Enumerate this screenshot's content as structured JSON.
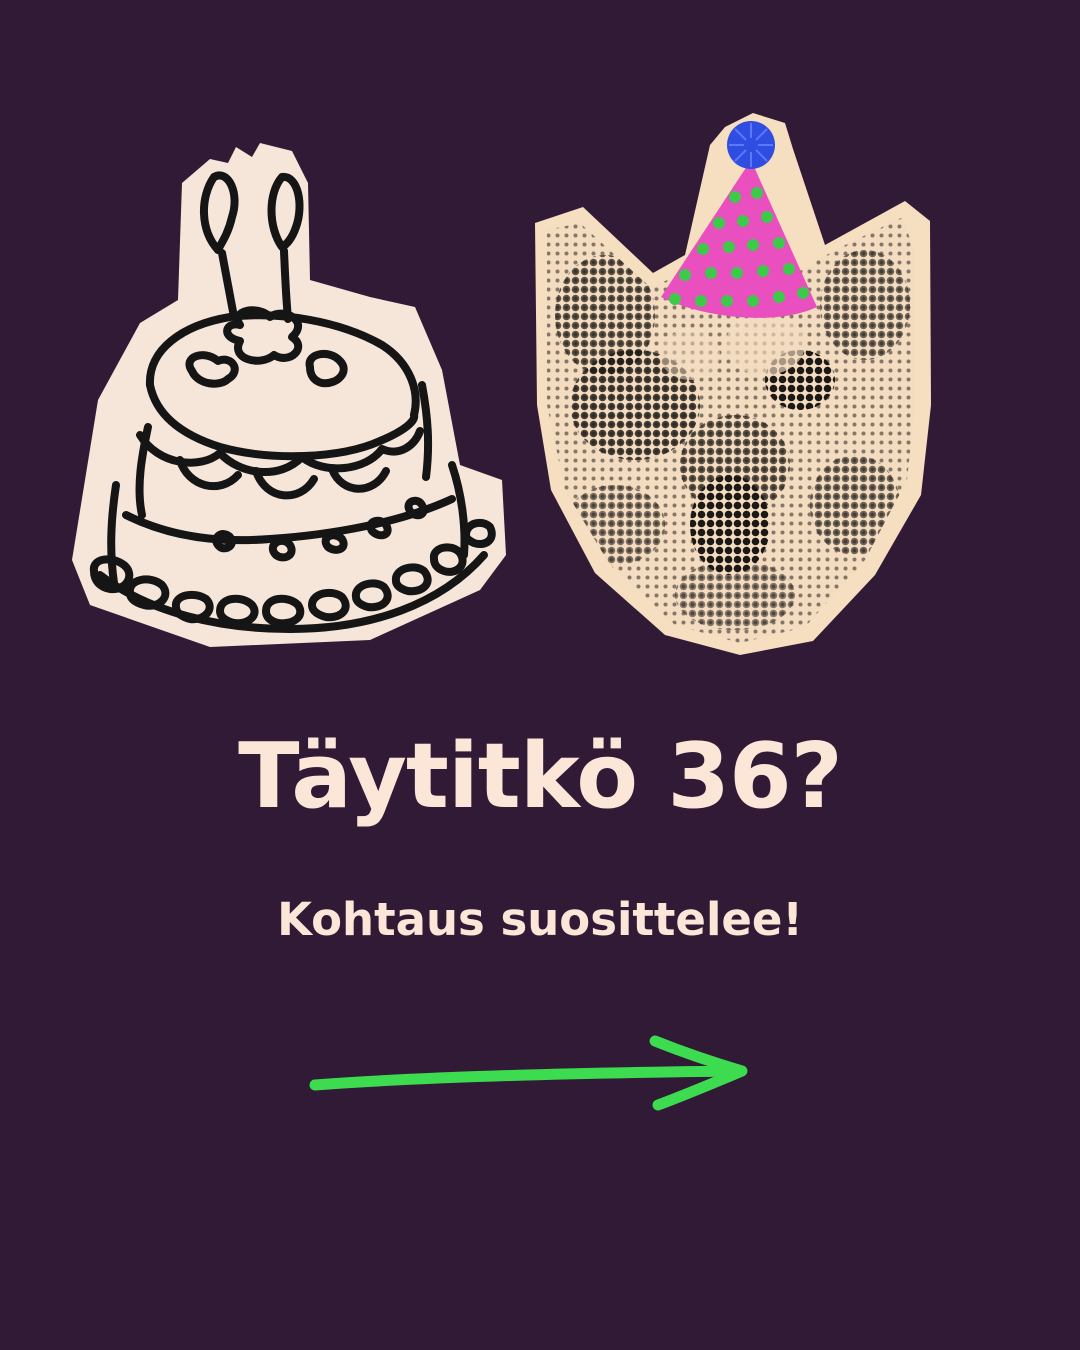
{
  "slide": {
    "headline": "Täytitkö 36?",
    "subline": "Kohtaus suosittelee!"
  },
  "illustrations": {
    "cake": {
      "icon": "birthday-cake-icon"
    },
    "cat": {
      "icon": "cat-with-party-hat-icon"
    },
    "arrow": {
      "icon": "arrow-right-icon"
    }
  },
  "colors": {
    "background": "#311A35",
    "text": "#FBE6D8",
    "sticker_paper": "#F6E6DA",
    "arrow": "#3DDB4F",
    "party_hat": "#E94FBE",
    "hat_dots": "#3DC94A",
    "pompom": "#2F4DE0"
  }
}
